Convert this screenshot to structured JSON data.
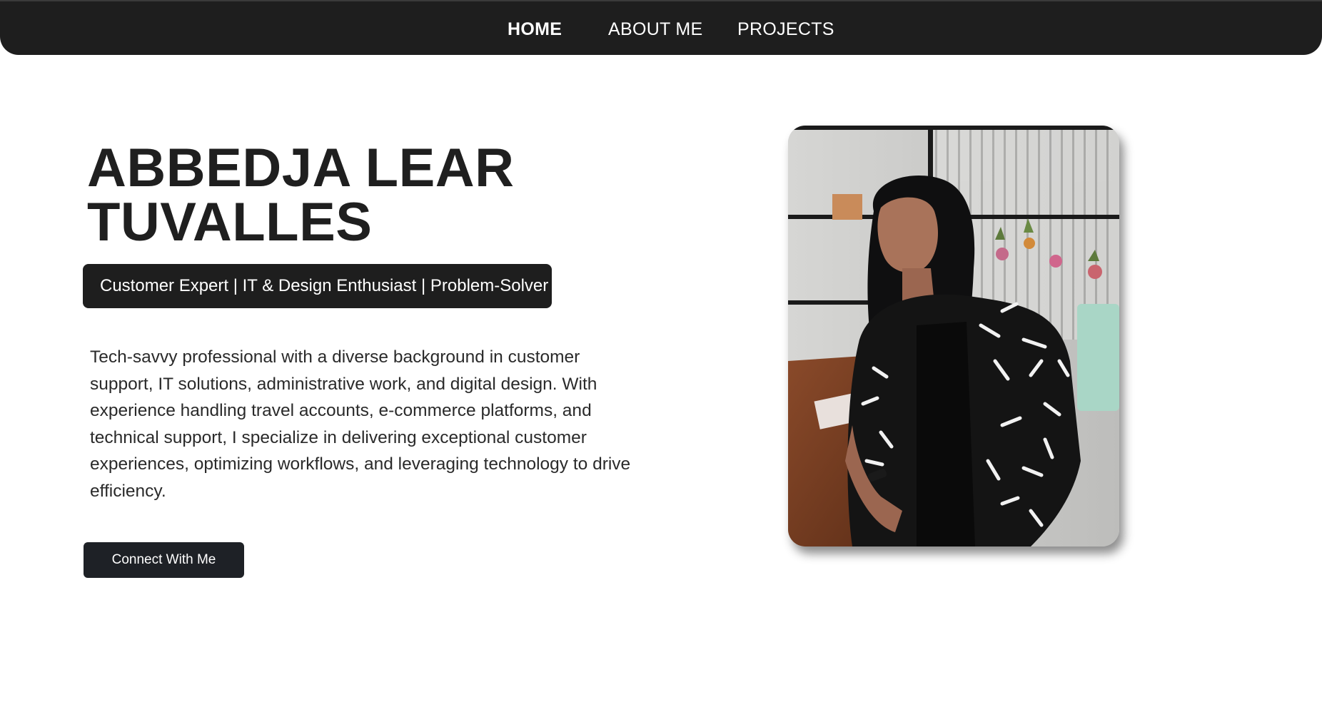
{
  "nav": {
    "items": [
      {
        "label": "HOME",
        "active": true
      },
      {
        "label": "ABOUT ME",
        "active": false
      },
      {
        "label": "PROJECTS",
        "active": false
      }
    ]
  },
  "hero": {
    "name": "ABBEDJA LEAR\nTUVALLES",
    "tagline": "Customer Expert | IT & Design Enthusiast | Problem-Solver",
    "bio": "Tech-savvy professional with a diverse background in customer support, IT solutions, administrative work, and digital design. With experience handling travel accounts, e-commerce platforms, and technical support, I specialize in delivering exceptional customer experiences, optimizing workflows, and leveraging technology to drive efficiency.",
    "cta_label": "Connect With Me"
  },
  "colors": {
    "navbar_bg": "#1e1e1e",
    "text_dark": "#1f1f1f",
    "button_bg": "#1e2126"
  }
}
